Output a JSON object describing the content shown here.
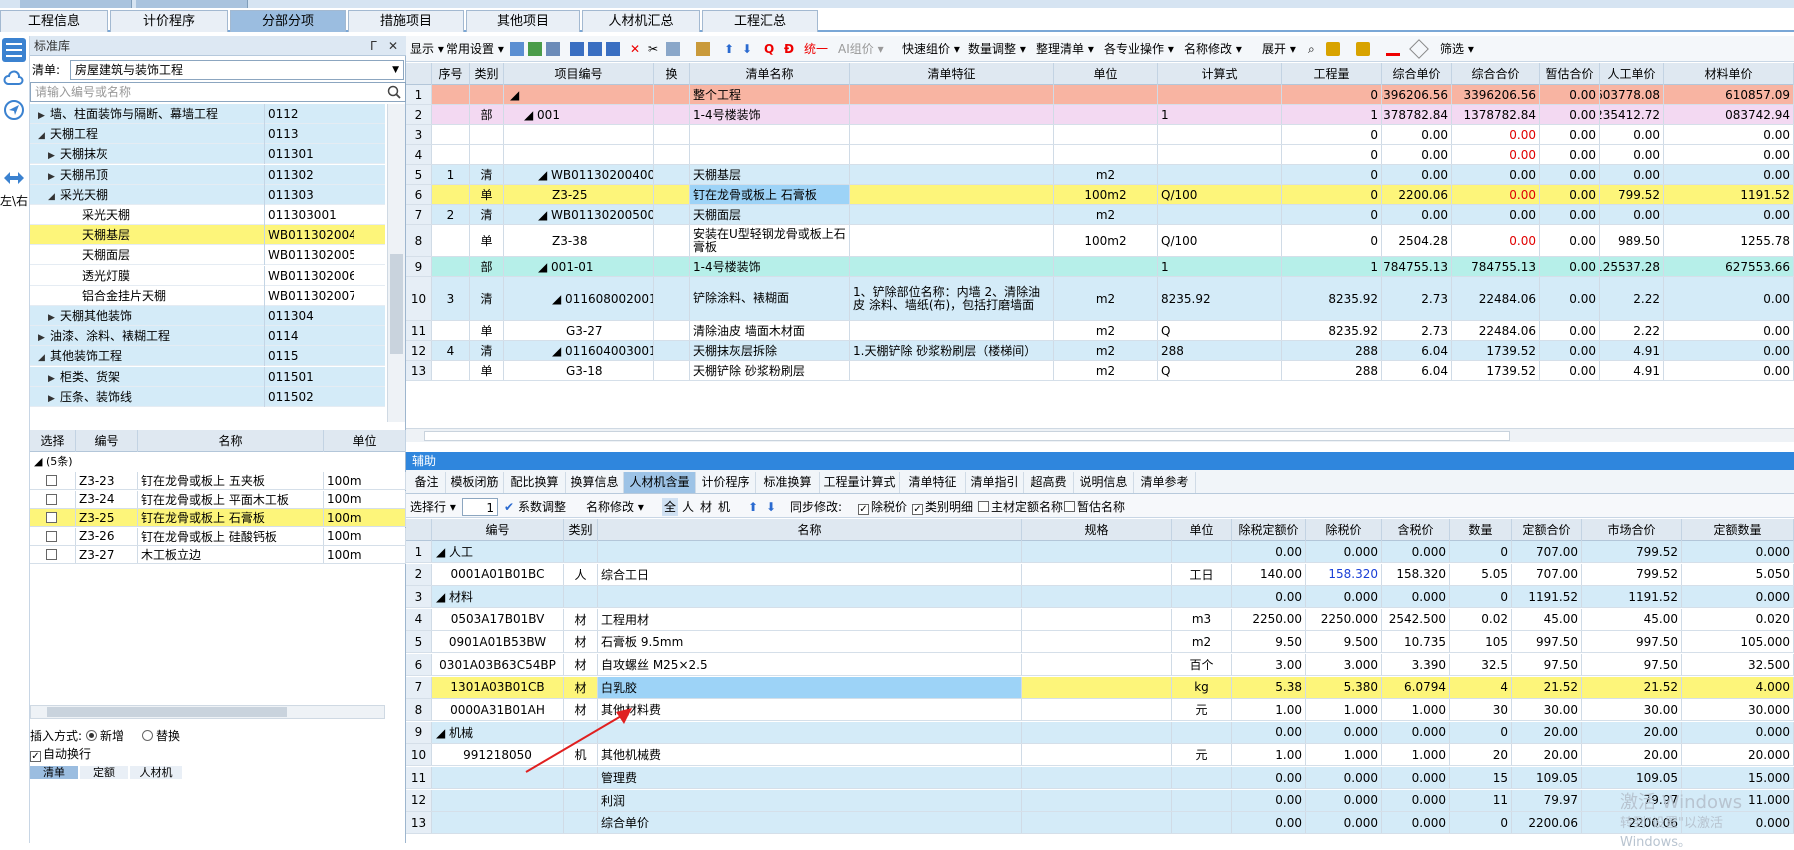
{
  "title_tabs": [
    "",
    ""
  ],
  "main_tabs": [
    "工程信息",
    "计价程序",
    "分部分项",
    "措施项目",
    "其他项目",
    "人材机汇总",
    "工程汇总"
  ],
  "left_icons": {
    "lr_label": "左\\右"
  },
  "std_lib": {
    "title": "标准库",
    "pin": "ᒥ",
    "close": "✕",
    "list_label": "清单:",
    "list_value": "房屋建筑与装饰工程",
    "search_placeholder": "请输入编号或名称"
  },
  "tree": [
    {
      "name": "墙、柱面装饰与隔断、幕墙工程",
      "code": "0112",
      "level": 1,
      "arrow": "▶"
    },
    {
      "name": "天棚工程",
      "code": "0113",
      "level": 1,
      "arrow": "◢"
    },
    {
      "name": "天棚抹灰",
      "code": "011301",
      "level": 2,
      "arrow": "▶"
    },
    {
      "name": "天棚吊顶",
      "code": "011302",
      "level": 2,
      "arrow": "▶"
    },
    {
      "name": "采光天棚",
      "code": "011303",
      "level": 2,
      "arrow": "◢"
    },
    {
      "name": "采光天棚",
      "code": "011303001",
      "level": 3,
      "arrow": ""
    },
    {
      "name": "天棚基层",
      "code": "WB011302004",
      "level": 3,
      "arrow": ""
    },
    {
      "name": "天棚面层",
      "code": "WB011302005",
      "level": 3,
      "arrow": ""
    },
    {
      "name": "透光灯膜",
      "code": "WB011302006",
      "level": 3,
      "arrow": ""
    },
    {
      "name": "铝合金挂片天棚",
      "code": "WB011302007",
      "level": 3,
      "arrow": ""
    },
    {
      "name": "天棚其他装饰",
      "code": "011304",
      "level": 2,
      "arrow": "▶"
    },
    {
      "name": "油漆、涂料、裱糊工程",
      "code": "0114",
      "level": 1,
      "arrow": "▶"
    },
    {
      "name": "其他装饰工程",
      "code": "0115",
      "level": 1,
      "arrow": "◢"
    },
    {
      "name": "柜类、货架",
      "code": "011501",
      "level": 2,
      "arrow": "▶"
    },
    {
      "name": "压条、装饰线",
      "code": "011502",
      "level": 2,
      "arrow": "▶"
    }
  ],
  "quota": {
    "headers": [
      "选择",
      "编号",
      "名称",
      "单位"
    ],
    "group": "◢ (5条)",
    "rows": [
      {
        "code": "Z3-23",
        "name": "钉在龙骨或板上 五夹板",
        "unit": "100m"
      },
      {
        "code": "Z3-24",
        "name": "钉在龙骨或板上 平面木工板",
        "unit": "100m"
      },
      {
        "code": "Z3-25",
        "name": "钉在龙骨或板上 石膏板",
        "unit": "100m"
      },
      {
        "code": "Z3-26",
        "name": "钉在龙骨或板上 硅酸钙板",
        "unit": "100m"
      },
      {
        "code": "Z3-27",
        "name": "木工板立边",
        "unit": "100m"
      }
    ]
  },
  "insert": {
    "label": "插入方式:",
    "opt_new": "新增",
    "opt_replace": "替换",
    "auto_wrap": "自动换行",
    "bottom_tabs": [
      "清单",
      "定额",
      "人材机"
    ]
  },
  "toolbar1": {
    "display": "显示 ▾",
    "common": "常用设置 ▾",
    "unify": "统一",
    "ai": "AI组价 ▾",
    "quick": "快速组价 ▾",
    "qty": "数量调整 ▾",
    "arrange": "整理清单 ▾",
    "major": "各专业操作 ▾",
    "rename": "名称修改 ▾",
    "expand": "展开 ▾",
    "filter": "筛选 ▾"
  },
  "main_grid": {
    "headers": [
      "",
      "序号",
      "类别",
      "项目编号",
      "换",
      "清单名称",
      "清单特征",
      "单位",
      "计算式",
      "工程量",
      "综合单价",
      "综合合价",
      "暂估合价",
      "人工单价",
      "材料单价"
    ],
    "rows": [
      {
        "n": "1",
        "seq": "",
        "type": "",
        "code": "◢",
        "swap": "",
        "name": "整个工程",
        "feature": "",
        "unit": "",
        "formula": "",
        "qty": "0",
        "up": "3396206.56",
        "tp": "3396206.56",
        "est": "0.00",
        "lab": "603778.08",
        "mat": "610857.09",
        "style": "salmon",
        "indent": 0
      },
      {
        "n": "2",
        "seq": "",
        "type": "部",
        "code": "◢ 001",
        "swap": "",
        "name": "1-4号楼装饰",
        "feature": "",
        "unit": "",
        "formula": "1",
        "qty": "1",
        "up": "1378782.84",
        "tp": "1378782.84",
        "est": "0.00",
        "lab": "235412.72",
        "mat": "083742.94",
        "style": "pink",
        "indent": 1
      },
      {
        "n": "3",
        "seq": "",
        "type": "",
        "code": "",
        "swap": "",
        "name": "",
        "feature": "",
        "unit": "",
        "formula": "",
        "qty": "0",
        "up": "0.00",
        "tp": "0.00",
        "est": "0.00",
        "lab": "0.00",
        "mat": "0.00",
        "style": "white",
        "redtp": true,
        "indent": 0
      },
      {
        "n": "4",
        "seq": "",
        "type": "",
        "code": "",
        "swap": "",
        "name": "",
        "feature": "",
        "unit": "",
        "formula": "",
        "qty": "0",
        "up": "0.00",
        "tp": "0.00",
        "est": "0.00",
        "lab": "0.00",
        "mat": "0.00",
        "style": "white",
        "redtp": true,
        "indent": 0
      },
      {
        "n": "5",
        "seq": "1",
        "type": "清",
        "code": "◢ WB011302004001",
        "swap": "",
        "name": "天棚基层",
        "feature": "",
        "unit": "m2",
        "formula": "",
        "qty": "0",
        "up": "0.00",
        "tp": "0.00",
        "est": "0.00",
        "lab": "0.00",
        "mat": "0.00",
        "style": "blue",
        "indent": 2
      },
      {
        "n": "6",
        "seq": "",
        "type": "单",
        "code": "Z3-25",
        "swap": "",
        "name": "钉在龙骨或板上 石膏板",
        "feature": "",
        "unit": "100m2",
        "formula": "Q/100",
        "qty": "0",
        "up": "2200.06",
        "tp": "0.00",
        "est": "0.00",
        "lab": "799.52",
        "mat": "1191.52",
        "style": "yellow",
        "redtp": true,
        "indent": 3
      },
      {
        "n": "7",
        "seq": "2",
        "type": "清",
        "code": "◢ WB011302005007",
        "swap": "",
        "name": "天棚面层",
        "feature": "",
        "unit": "m2",
        "formula": "",
        "qty": "0",
        "up": "0.00",
        "tp": "0.00",
        "est": "0.00",
        "lab": "0.00",
        "mat": "0.00",
        "style": "blue",
        "indent": 2
      },
      {
        "n": "8",
        "seq": "",
        "type": "单",
        "code": "Z3-38",
        "swap": "",
        "name": "安装在U型轻钢龙骨或板上石膏板",
        "feature": "",
        "unit": "100m2",
        "formula": "Q/100",
        "qty": "0",
        "up": "2504.28",
        "tp": "0.00",
        "est": "0.00",
        "lab": "989.50",
        "mat": "1255.78",
        "style": "white",
        "redtp": true,
        "indent": 3,
        "tall": true
      },
      {
        "n": "9",
        "seq": "",
        "type": "部",
        "code": "◢ 001-01",
        "swap": "",
        "name": "1-4号楼装饰",
        "feature": "",
        "unit": "",
        "formula": "1",
        "qty": "1",
        "up": "784755.13",
        "tp": "784755.13",
        "est": "0.00",
        "lab": "125537.28",
        "mat": "627553.66",
        "style": "cyan",
        "indent": 2
      },
      {
        "n": "10",
        "seq": "3",
        "type": "清",
        "code": "◢ 011608002001",
        "swap": "",
        "name": "铲除涂料、裱糊面",
        "feature": "1、铲除部位名称：内墙\n2、清除油皮 涂料、墙纸(布)，包括打磨墙面",
        "unit": "m2",
        "formula": "8235.92",
        "qty": "8235.92",
        "up": "2.73",
        "tp": "22484.06",
        "est": "0.00",
        "lab": "2.22",
        "mat": "0.00",
        "style": "blue",
        "indent": 3,
        "xtall": true
      },
      {
        "n": "11",
        "seq": "",
        "type": "单",
        "code": "G3-27",
        "swap": "",
        "name": "清除油皮 墙面木材面",
        "feature": "",
        "unit": "m2",
        "formula": "Q",
        "qty": "8235.92",
        "up": "2.73",
        "tp": "22484.06",
        "est": "0.00",
        "lab": "2.22",
        "mat": "0.00",
        "style": "white",
        "indent": 4
      },
      {
        "n": "12",
        "seq": "4",
        "type": "清",
        "code": "◢ 011604003001",
        "swap": "",
        "name": "天棚抹灰层拆除",
        "feature": "1.天棚铲除 砂浆粉刷层（楼梯间）",
        "unit": "m2",
        "formula": "288",
        "qty": "288",
        "up": "6.04",
        "tp": "1739.52",
        "est": "0.00",
        "lab": "4.91",
        "mat": "0.00",
        "style": "blue",
        "indent": 3
      },
      {
        "n": "13",
        "seq": "",
        "type": "单",
        "code": "G3-18",
        "swap": "",
        "name": "天棚铲除 砂浆粉刷层",
        "feature": "",
        "unit": "m2",
        "formula": "Q",
        "qty": "288",
        "up": "6.04",
        "tp": "1739.52",
        "est": "0.00",
        "lab": "4.91",
        "mat": "0.00",
        "style": "white",
        "indent": 4
      }
    ]
  },
  "aux_title": "辅助",
  "sub_tabs": [
    "备注",
    "模板闭筋",
    "配比换算",
    "换算信息",
    "人材机含量",
    "计价程序",
    "标准换算",
    "工程量计算式",
    "清单特征",
    "清单指引",
    "超高费",
    "说明信息",
    "清单参考"
  ],
  "toolbar2": {
    "select_row": "选择行 ▾",
    "row_num": "1",
    "coef": "系数调整",
    "rename": "名称修改 ▾",
    "filters": [
      "全",
      "人",
      "材",
      "机"
    ],
    "sync": "同步修改:",
    "tax": "除税价",
    "detail": "类别明细",
    "main_mat": "主材定额名称",
    "est_name": "暂估名称"
  },
  "res_grid": {
    "headers": [
      "",
      "编号",
      "类别",
      "名称",
      "规格",
      "单位",
      "除税定额价",
      "除税价",
      "含税价",
      "数量",
      "定额合价",
      "市场合价",
      "定额数量"
    ],
    "rows": [
      {
        "n": "1",
        "code": "◢ 人工",
        "type": "",
        "name": "",
        "spec": "",
        "unit": "",
        "p1": "0.00",
        "p2": "0.000",
        "p3": "0.000",
        "q": "0",
        "t1": "707.00",
        "t2": "799.52",
        "dq": "0.000",
        "style": "blue",
        "group": true
      },
      {
        "n": "2",
        "code": "0001A01B01BC",
        "type": "人",
        "name": "综合工日",
        "spec": "",
        "unit": "工日",
        "p1": "140.00",
        "p2": "158.320",
        "p3": "158.320",
        "q": "5.05",
        "t1": "707.00",
        "t2": "799.52",
        "dq": "5.050",
        "style": "white",
        "p2blue": true
      },
      {
        "n": "3",
        "code": "◢ 材料",
        "type": "",
        "name": "",
        "spec": "",
        "unit": "",
        "p1": "0.00",
        "p2": "0.000",
        "p3": "0.000",
        "q": "0",
        "t1": "1191.52",
        "t2": "1191.52",
        "dq": "0.000",
        "style": "blue",
        "group": true
      },
      {
        "n": "4",
        "code": "0503A17B01BV",
        "type": "材",
        "name": "工程用材",
        "spec": "",
        "unit": "m3",
        "p1": "2250.00",
        "p2": "2250.000",
        "p3": "2542.500",
        "q": "0.02",
        "t1": "45.00",
        "t2": "45.00",
        "dq": "0.020",
        "style": "white"
      },
      {
        "n": "5",
        "code": "0901A01B53BW",
        "type": "材",
        "name": "石膏板 9.5mm",
        "spec": "",
        "unit": "m2",
        "p1": "9.50",
        "p2": "9.500",
        "p3": "10.735",
        "q": "105",
        "t1": "997.50",
        "t2": "997.50",
        "dq": "105.000",
        "style": "white"
      },
      {
        "n": "6",
        "code": "0301A03B63C54BP",
        "type": "材",
        "name": "自攻螺丝 M25×2.5",
        "spec": "",
        "unit": "百个",
        "p1": "3.00",
        "p2": "3.000",
        "p3": "3.390",
        "q": "32.5",
        "t1": "97.50",
        "t2": "97.50",
        "dq": "32.500",
        "style": "white"
      },
      {
        "n": "7",
        "code": "1301A03B01CB",
        "type": "材",
        "name": "白乳胶",
        "spec": "",
        "unit": "kg",
        "p1": "5.38",
        "p2": "5.380",
        "p3": "6.0794",
        "q": "4",
        "t1": "21.52",
        "t2": "21.52",
        "dq": "4.000",
        "style": "yellow"
      },
      {
        "n": "8",
        "code": "0000A31B01AH",
        "type": "材",
        "name": "其他材料费",
        "spec": "",
        "unit": "元",
        "p1": "1.00",
        "p2": "1.000",
        "p3": "1.000",
        "q": "30",
        "t1": "30.00",
        "t2": "30.00",
        "dq": "30.000",
        "style": "white"
      },
      {
        "n": "9",
        "code": "◢ 机械",
        "type": "",
        "name": "",
        "spec": "",
        "unit": "",
        "p1": "0.00",
        "p2": "0.000",
        "p3": "0.000",
        "q": "0",
        "t1": "20.00",
        "t2": "20.00",
        "dq": "0.000",
        "style": "blue",
        "group": true
      },
      {
        "n": "10",
        "code": "991218050",
        "type": "机",
        "name": "其他机械费",
        "spec": "",
        "unit": "元",
        "p1": "1.00",
        "p2": "1.000",
        "p3": "1.000",
        "q": "20",
        "t1": "20.00",
        "t2": "20.00",
        "dq": "20.000",
        "style": "white"
      },
      {
        "n": "11",
        "code": "",
        "type": "",
        "name": "管理费",
        "spec": "",
        "unit": "",
        "p1": "0.00",
        "p2": "0.000",
        "p3": "0.000",
        "q": "15",
        "t1": "109.05",
        "t2": "109.05",
        "dq": "15.000",
        "style": "blue"
      },
      {
        "n": "12",
        "code": "",
        "type": "",
        "name": "利润",
        "spec": "",
        "unit": "",
        "p1": "0.00",
        "p2": "0.000",
        "p3": "0.000",
        "q": "11",
        "t1": "79.97",
        "t2": "79.97",
        "dq": "11.000",
        "style": "blue"
      },
      {
        "n": "13",
        "code": "",
        "type": "",
        "name": "综合单价",
        "spec": "",
        "unit": "",
        "p1": "0.00",
        "p2": "0.000",
        "p3": "0.000",
        "q": "0",
        "t1": "2200.06",
        "t2": "2200.06",
        "dq": "0.000",
        "style": "blue"
      }
    ]
  },
  "watermark": {
    "line1": "激活 Windows",
    "line2": "转到\"设置\"以激活 Windows。"
  },
  "colors": {
    "accent": "#2f86dd",
    "highlight_yellow": "#fdf57a",
    "select_blue": "#9dd3f7",
    "salmon": "#f8b4a2",
    "pink": "#f3d9f2",
    "cyan": "#b6efe9",
    "row_blue": "#d4ebf8",
    "arrow_red": "#e02020"
  }
}
